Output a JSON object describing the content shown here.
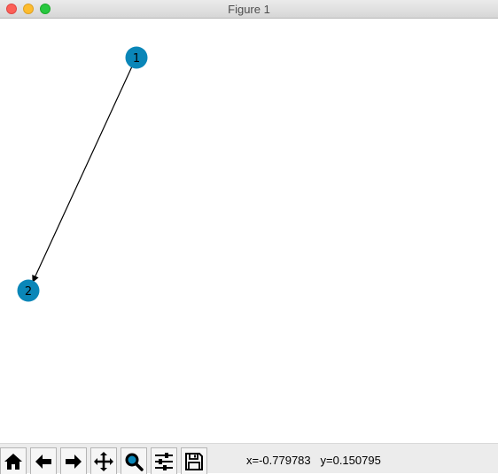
{
  "window": {
    "title": "Figure 1"
  },
  "graph": {
    "node_color": "#0a86b8",
    "edge_color": "#000000",
    "nodes": [
      {
        "id": "1",
        "label": "1"
      },
      {
        "id": "2",
        "label": "2"
      }
    ],
    "edges": [
      {
        "from": "1",
        "to": "2",
        "directed": true
      }
    ]
  },
  "toolbar": {
    "buttons": [
      {
        "name": "home-icon"
      },
      {
        "name": "back-arrow-icon"
      },
      {
        "name": "forward-arrow-icon"
      },
      {
        "name": "pan-move-icon"
      },
      {
        "name": "zoom-magnifier-icon"
      },
      {
        "name": "configure-subplots-icon"
      },
      {
        "name": "save-disk-icon"
      }
    ],
    "x_readout": "x=-0.779783",
    "y_readout": "y=0.150795"
  }
}
